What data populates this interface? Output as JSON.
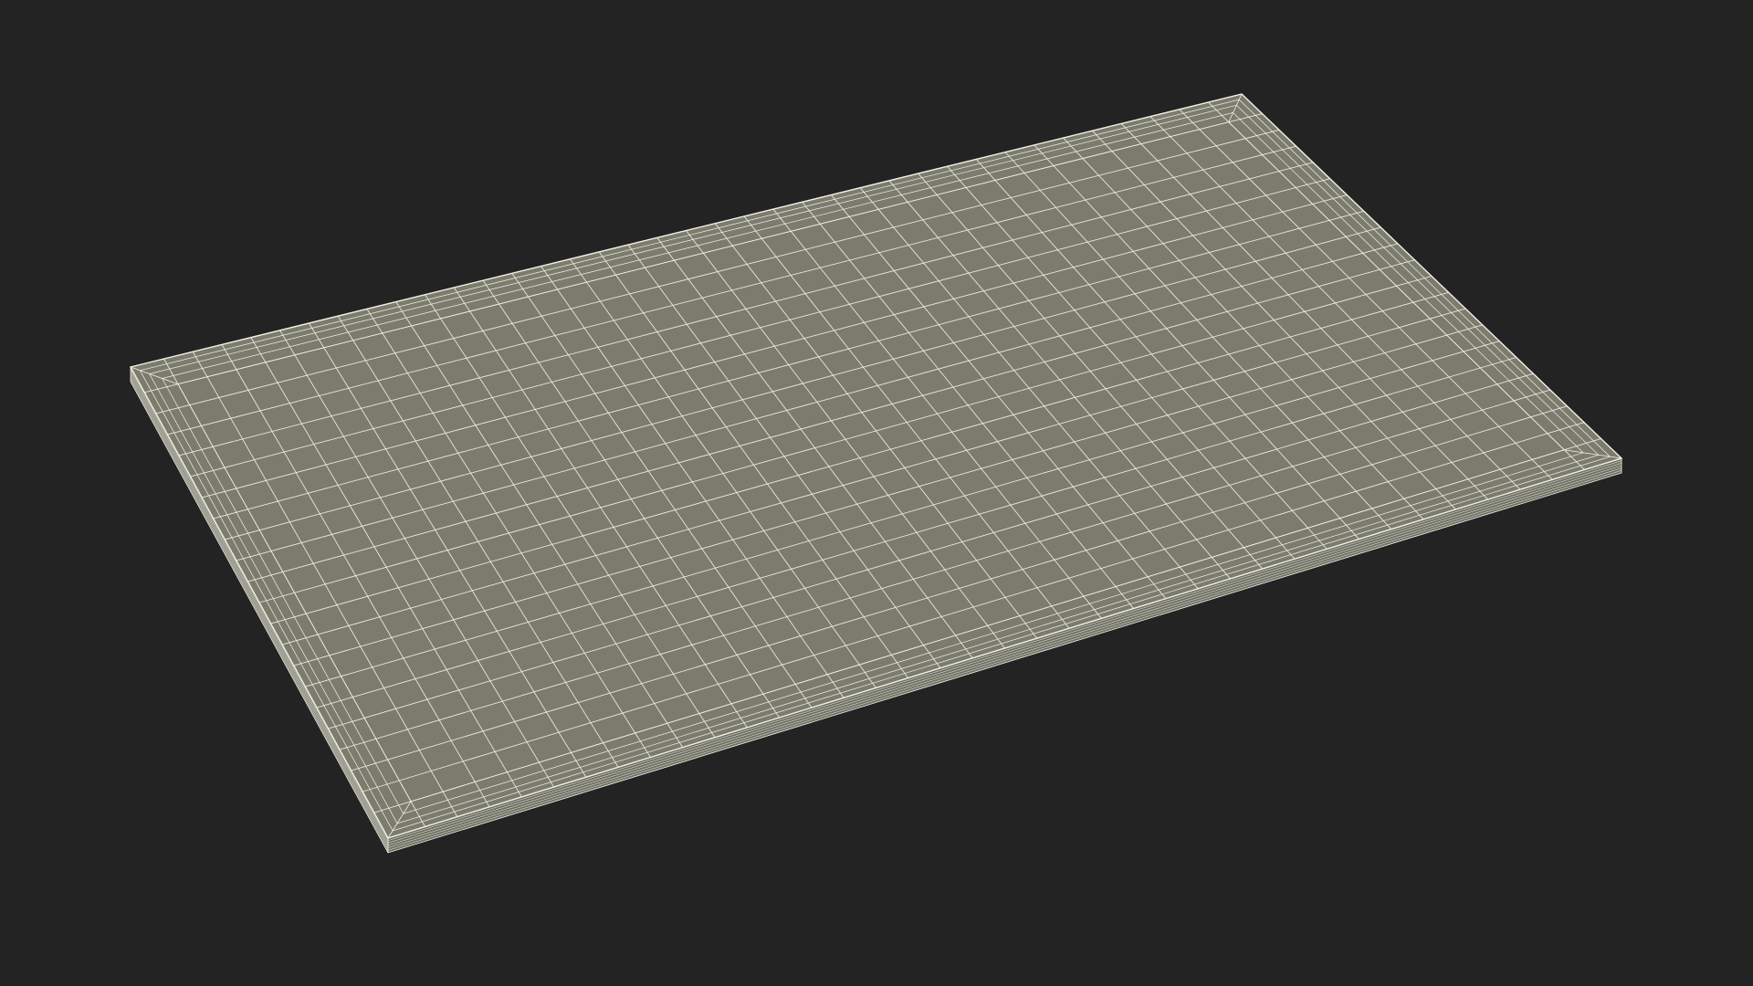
{
  "scene": {
    "subject": "wireframe-rectangular-board",
    "background_color": "#232323",
    "surface_color": "#7b7c6e",
    "edge_color": "#8a8b7d",
    "side_color": "#6f7064",
    "wire_color": "#f2f1e6",
    "grid_columns": 36,
    "grid_rows": 20
  }
}
